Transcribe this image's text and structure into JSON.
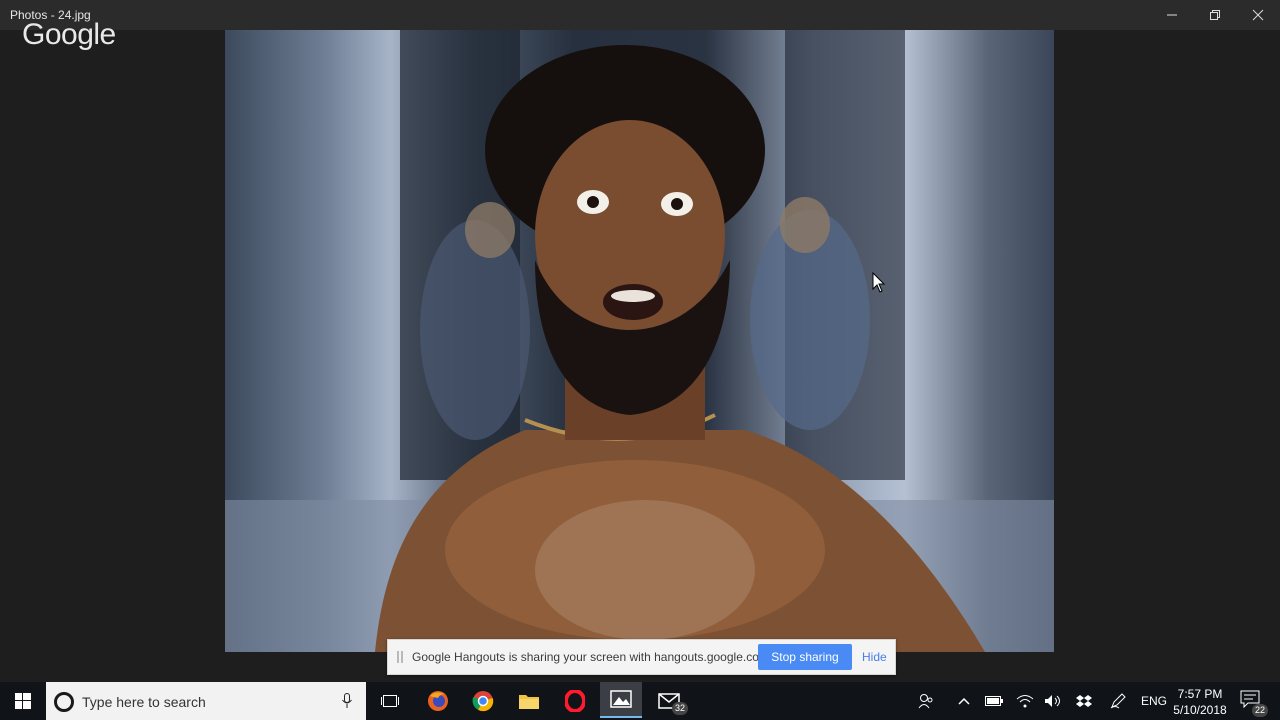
{
  "window": {
    "title": "Photos - 24.jpg",
    "watermark": "Google",
    "controls": [
      "minimize",
      "restore",
      "close"
    ]
  },
  "share_bar": {
    "message": "Google Hangouts is sharing your screen with hangouts.google.com.",
    "stop_label": "Stop sharing",
    "hide_label": "Hide",
    "accent": "#4a8af4"
  },
  "taskbar": {
    "search_placeholder": "Type here to search",
    "pinned": [
      {
        "name": "task-view-icon"
      },
      {
        "name": "firefox-icon"
      },
      {
        "name": "chrome-icon"
      },
      {
        "name": "file-explorer-icon"
      },
      {
        "name": "opera-icon"
      },
      {
        "name": "photos-icon",
        "active": true
      },
      {
        "name": "mail-icon",
        "badge": "32"
      }
    ],
    "tray": {
      "language": "ENG",
      "time": "7:57 PM",
      "date": "5/10/2018",
      "notifications": "22"
    }
  }
}
